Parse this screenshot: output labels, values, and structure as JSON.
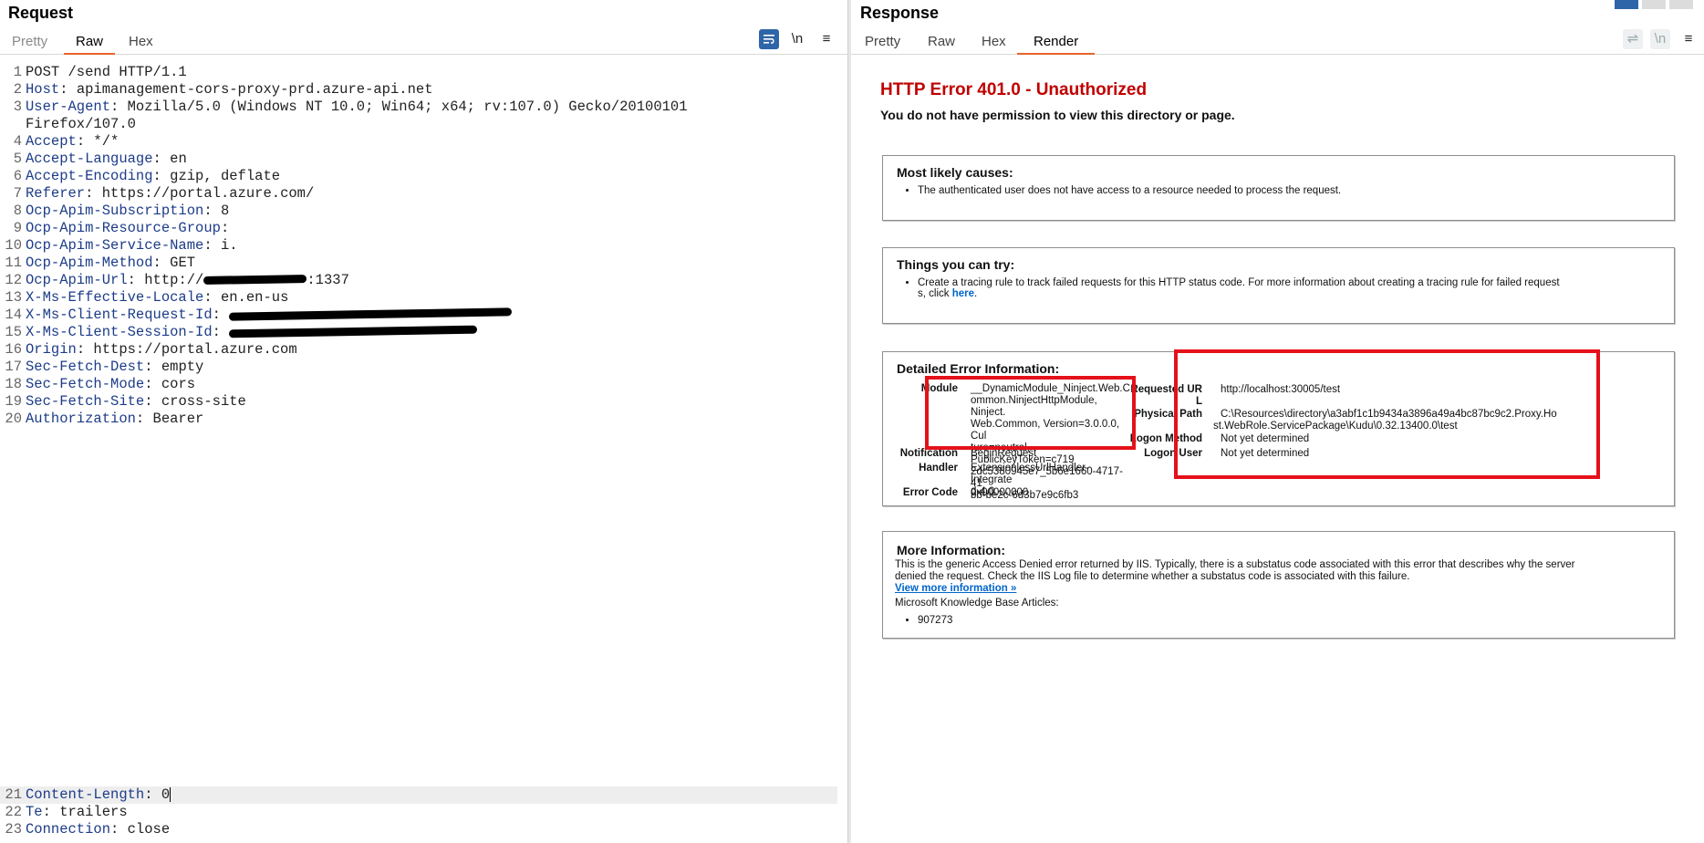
{
  "request": {
    "title": "Request",
    "tabs": [
      {
        "label": "Pretty",
        "state": "disabled"
      },
      {
        "label": "Raw",
        "state": "active"
      },
      {
        "label": "Hex",
        "state": "normal"
      }
    ],
    "tools": {
      "wrap_icon": "wrap-lines-icon",
      "newline_label": "\\n",
      "menu_icon": "hamburger-menu-icon"
    },
    "lines": [
      {
        "n": "1",
        "text": "POST /send HTTP/1.1"
      },
      {
        "n": "2",
        "name": "Host",
        "value": "apimanagement-cors-proxy-prd.azure-api.net"
      },
      {
        "n": "3",
        "name": "User-Agent",
        "value": "Mozilla/5.0 (Windows NT 10.0; Win64; x64; rv:107.0) Gecko/20100101"
      },
      {
        "n": "",
        "text": "Firefox/107.0"
      },
      {
        "n": "4",
        "name": "Accept",
        "value": "*/*"
      },
      {
        "n": "5",
        "name": "Accept-Language",
        "value": "en"
      },
      {
        "n": "6",
        "name": "Accept-Encoding",
        "value": "gzip, deflate"
      },
      {
        "n": "7",
        "name": "Referer",
        "value": "https://portal.azure.com/"
      },
      {
        "n": "8",
        "name": "Ocp-Apim-Subscription",
        "value": "8"
      },
      {
        "n": "9",
        "name": "Ocp-Apim-Resource-Group",
        "value": ""
      },
      {
        "n": "10",
        "name": "Ocp-Apim-Service-Name",
        "value": "i."
      },
      {
        "n": "11",
        "name": "Ocp-Apim-Method",
        "value": "GET"
      },
      {
        "n": "12",
        "name": "Ocp-Apim-Url",
        "value": "http://",
        "tail": ":1337",
        "redact": 1
      },
      {
        "n": "13",
        "name": "X-Ms-Effective-Locale",
        "value": "en.en-us"
      },
      {
        "n": "14",
        "name": "X-Ms-Client-Request-Id",
        "value": "",
        "redact": 2
      },
      {
        "n": "15",
        "name": "X-Ms-Client-Session-Id",
        "value": "",
        "redact": 3
      },
      {
        "n": "16",
        "name": "Origin",
        "value": "https://portal.azure.com"
      },
      {
        "n": "17",
        "name": "Sec-Fetch-Dest",
        "value": "empty"
      },
      {
        "n": "18",
        "name": "Sec-Fetch-Mode",
        "value": "cors"
      },
      {
        "n": "19",
        "name": "Sec-Fetch-Site",
        "value": "cross-site"
      },
      {
        "n": "20",
        "name": "Authorization",
        "value": "Bearer"
      }
    ],
    "tail_lines": [
      {
        "n": "21",
        "name": "Content-Length",
        "value": "0",
        "caret": true
      },
      {
        "n": "22",
        "name": "Te",
        "value": "trailers"
      },
      {
        "n": "23",
        "name": "Connection",
        "value": "close"
      }
    ]
  },
  "response": {
    "title": "Response",
    "tabs": [
      {
        "label": "Pretty",
        "state": "normal"
      },
      {
        "label": "Raw",
        "state": "normal"
      },
      {
        "label": "Hex",
        "state": "normal"
      },
      {
        "label": "Render",
        "state": "active"
      }
    ],
    "tools": {
      "wrap_icon": "wrap-lines-icon",
      "newline_label": "\\n",
      "menu_icon": "hamburger-menu-icon"
    },
    "error_title": "HTTP Error 401.0 - Unauthorized",
    "error_subtitle": "You do not have permission to view this directory or page.",
    "causes": {
      "heading": "Most likely causes:",
      "items": [
        "The authenticated user does not have access to a resource needed to process the request."
      ]
    },
    "try": {
      "heading": "Things you can try:",
      "text_line1": "Create a tracing rule to track failed requests for this HTTP status code. For more information about creating a tracing rule for failed request",
      "text_line2_pre": "s, click ",
      "link": "here",
      "text_line2_post": "."
    },
    "detail": {
      "heading": "Detailed Error Information:",
      "module_label": "Module",
      "module_value": [
        "__DynamicModule_Ninject.Web.C",
        "ommon.NinjectHttpModule, Ninject.",
        "Web.Common, Version=3.0.0.0, Cul",
        "ture=neutral, PublicKeyToken=c719",
        "2dc5380945e7_5b6e1660-4717-41",
        "bb-be2c-6d3b7e9c6fb3"
      ],
      "notification_label": "Notification",
      "notification_value": "BeginRequest",
      "handler_label": "Handler",
      "handler_value": [
        "ExtensionlessUrlHandler-Integrate",
        "d-4.0"
      ],
      "error_code_label": "Error Code",
      "error_code_value": "0x00000000",
      "requested_url_label": [
        "Requested UR",
        "L"
      ],
      "requested_url_value": "http://localhost:30005/test",
      "physical_path_label": "Physical Path",
      "physical_path_value": [
        "C:\\Resources\\directory\\a3abf1c1b9434a3896a49a4bc87bc9c2.Proxy.Ho",
        "st.WebRole.ServicePackage\\Kudu\\0.32.13400.0\\test"
      ],
      "logon_method_label": "Logon Method",
      "logon_method_value": "Not yet determined",
      "logon_user_label": "Logon User",
      "logon_user_value": "Not yet determined"
    },
    "more": {
      "heading": "More Information:",
      "text_line1": "This is the generic Access Denied error returned by IIS. Typically, there is a substatus code associated with this error that describes why the server",
      "text_line2": "denied the request. Check the IIS Log file to determine whether a substatus code is associated with this failure.",
      "link": "View more information »",
      "kb_label": "Microsoft Knowledge Base Articles:",
      "kb_items": [
        "907273"
      ]
    }
  },
  "colors": {
    "accent": "#e8632b",
    "primary": "#2e65a8",
    "error": "#c00000",
    "highlight": "#e4111a",
    "header_name": "#1d3c88"
  }
}
